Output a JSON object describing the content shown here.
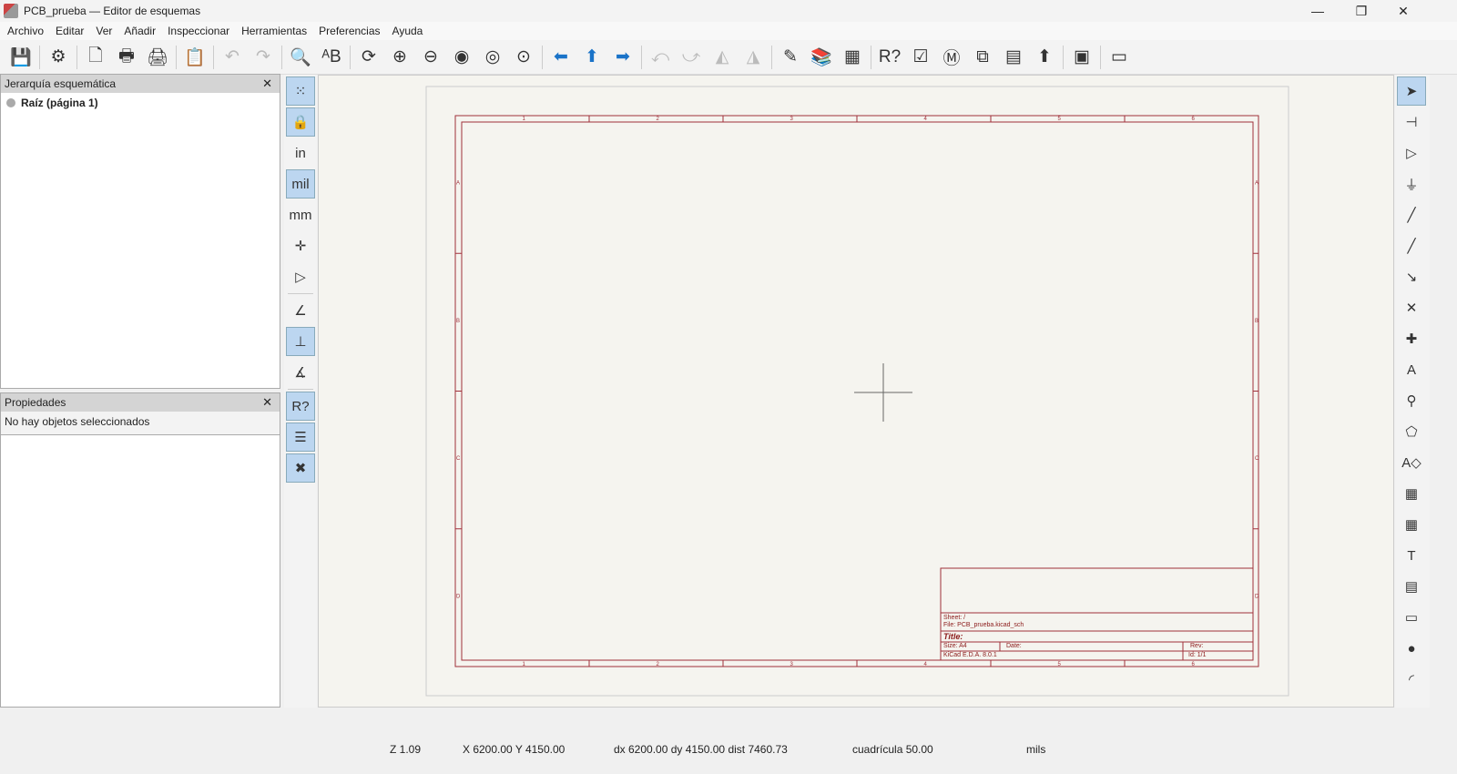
{
  "window": {
    "title": "PCB_prueba — Editor de esquemas",
    "minimize": "—",
    "maximize": "❐",
    "close": "✕"
  },
  "menu": [
    "Archivo",
    "Editar",
    "Ver",
    "Añadir",
    "Inspeccionar",
    "Herramientas",
    "Preferencias",
    "Ayuda"
  ],
  "toolbar": [
    {
      "icon": "save-icon",
      "glyph": "💾"
    },
    {
      "sep": true
    },
    {
      "icon": "schematic-setup-icon",
      "glyph": "⚙"
    },
    {
      "sep": true
    },
    {
      "icon": "page-settings-icon",
      "glyph": "🗋"
    },
    {
      "icon": "print-icon",
      "glyph": "🖶"
    },
    {
      "icon": "plot-icon",
      "glyph": "🖨"
    },
    {
      "sep": true
    },
    {
      "icon": "paste-icon",
      "glyph": "📋"
    },
    {
      "sep": true
    },
    {
      "icon": "undo-icon",
      "glyph": "↶",
      "dim": true
    },
    {
      "icon": "redo-icon",
      "glyph": "↷",
      "dim": true
    },
    {
      "sep": true
    },
    {
      "icon": "find-icon",
      "glyph": "🔍"
    },
    {
      "icon": "find-replace-icon",
      "glyph": "ᴬB"
    },
    {
      "sep": true
    },
    {
      "icon": "refresh-icon",
      "glyph": "⟳"
    },
    {
      "icon": "zoom-in-icon",
      "glyph": "⊕"
    },
    {
      "icon": "zoom-out-icon",
      "glyph": "⊖"
    },
    {
      "icon": "zoom-fit-icon",
      "glyph": "◉"
    },
    {
      "icon": "zoom-objects-icon",
      "glyph": "◎"
    },
    {
      "icon": "zoom-selection-icon",
      "glyph": "⊙"
    },
    {
      "sep": true
    },
    {
      "icon": "navigate-back-icon",
      "glyph": "⬅",
      "blue": true
    },
    {
      "icon": "navigate-up-icon",
      "glyph": "⬆",
      "blue": true
    },
    {
      "icon": "navigate-forward-icon",
      "glyph": "➡",
      "blue": true
    },
    {
      "sep": true
    },
    {
      "icon": "rotate-ccw-icon",
      "glyph": "⤺",
      "dim": true
    },
    {
      "icon": "rotate-cw-icon",
      "glyph": "⤻",
      "dim": true
    },
    {
      "icon": "mirror-v-icon",
      "glyph": "◭",
      "dim": true
    },
    {
      "icon": "mirror-h-icon",
      "glyph": "◮",
      "dim": true
    },
    {
      "sep": true
    },
    {
      "icon": "symbol-editor-icon",
      "glyph": "✎"
    },
    {
      "icon": "symbol-browser-icon",
      "glyph": "📚"
    },
    {
      "icon": "footprint-editor-icon",
      "glyph": "▦"
    },
    {
      "sep": true
    },
    {
      "icon": "annotate-icon",
      "glyph": "R?"
    },
    {
      "icon": "erc-icon",
      "glyph": "☑"
    },
    {
      "icon": "simulator-icon",
      "glyph": "Ⓜ"
    },
    {
      "icon": "assign-footprints-icon",
      "glyph": "⧉"
    },
    {
      "icon": "fields-table-icon",
      "glyph": "▤"
    },
    {
      "icon": "bom-icon",
      "glyph": "⬆"
    },
    {
      "sep": true
    },
    {
      "icon": "pcb-editor-icon",
      "glyph": "▣"
    },
    {
      "sep": true
    },
    {
      "icon": "scripting-console-icon",
      "glyph": "▭"
    }
  ],
  "left_toolbar": [
    {
      "icon": "grid-icon",
      "glyph": "⁙",
      "on": true
    },
    {
      "icon": "grid-lock-icon",
      "glyph": "🔒",
      "on": true
    },
    {
      "icon": "units-inch-icon",
      "glyph": "in"
    },
    {
      "icon": "units-mil-icon",
      "glyph": "mil",
      "on": true
    },
    {
      "icon": "units-mm-icon",
      "glyph": "mm"
    },
    {
      "icon": "cursor-shape-icon",
      "glyph": "✛"
    },
    {
      "icon": "hidden-pins-icon",
      "glyph": "▷"
    },
    {
      "sep": true
    },
    {
      "icon": "line-mode-free-icon",
      "glyph": "∠"
    },
    {
      "icon": "line-mode-90-icon",
      "glyph": "⊥",
      "on": true
    },
    {
      "icon": "line-mode-45-icon",
      "glyph": "∡"
    },
    {
      "sep": true
    },
    {
      "icon": "annotate-auto-icon",
      "glyph": "R?",
      "on": true
    },
    {
      "icon": "hierarchy-panel-icon",
      "glyph": "☰",
      "on": true
    },
    {
      "icon": "properties-panel-icon",
      "glyph": "✖",
      "on": true
    }
  ],
  "right_toolbar": [
    {
      "icon": "select-arrow-icon",
      "glyph": "➤",
      "on": true
    },
    {
      "icon": "highlight-net-icon",
      "glyph": "⊣"
    },
    {
      "icon": "add-symbol-icon",
      "glyph": "▷"
    },
    {
      "icon": "add-power-icon",
      "glyph": "⏚"
    },
    {
      "icon": "add-wire-icon",
      "glyph": "╱"
    },
    {
      "icon": "add-bus-icon",
      "glyph": "╱"
    },
    {
      "icon": "add-bus-entry-icon",
      "glyph": "↘"
    },
    {
      "icon": "no-connect-icon",
      "glyph": "✕"
    },
    {
      "icon": "add-junction-icon",
      "glyph": "✚"
    },
    {
      "icon": "add-label-icon",
      "glyph": "A"
    },
    {
      "icon": "add-global-label-icon",
      "glyph": "⚲"
    },
    {
      "icon": "add-hier-label-icon",
      "glyph": "⬠"
    },
    {
      "icon": "add-directive-label-icon",
      "glyph": "A◇"
    },
    {
      "icon": "add-sheet-icon",
      "glyph": "▦"
    },
    {
      "icon": "import-sheet-pin-icon",
      "glyph": "▦"
    },
    {
      "icon": "add-text-icon",
      "glyph": "T"
    },
    {
      "icon": "add-textbox-icon",
      "glyph": "▤"
    },
    {
      "icon": "add-rectangle-icon",
      "glyph": "▭"
    },
    {
      "icon": "add-circle-icon",
      "glyph": "●"
    },
    {
      "icon": "add-arc-icon",
      "glyph": "◜"
    }
  ],
  "hierarchy": {
    "title": "Jerarquía esquemática",
    "close": "✕",
    "root": "Raíz (página 1)"
  },
  "properties": {
    "title": "Propiedades",
    "close": "✕",
    "empty": "No hay objetos seleccionados"
  },
  "title_block": {
    "sheet": "Sheet: /",
    "file": "File: PCB_prueba.kicad_sch",
    "title": "Title:",
    "size": "Size: A4",
    "date": "Date:",
    "rev": "Rev:",
    "kicad": "KiCad E.D.A. 8.0.1",
    "id": "Id: 1/1"
  },
  "border": {
    "cols": [
      "1",
      "2",
      "3",
      "4",
      "5",
      "6"
    ],
    "rows": [
      "A",
      "B",
      "C",
      "D"
    ],
    "color": "#a0303a"
  },
  "status": {
    "zoom": "Z 1.09",
    "xy": "X 6200.00  Y 4150.00",
    "delta": "dx 6200.00  dy 4150.00  dist 7460.73",
    "grid": "cuadrícula 50.00",
    "units": "mils"
  }
}
